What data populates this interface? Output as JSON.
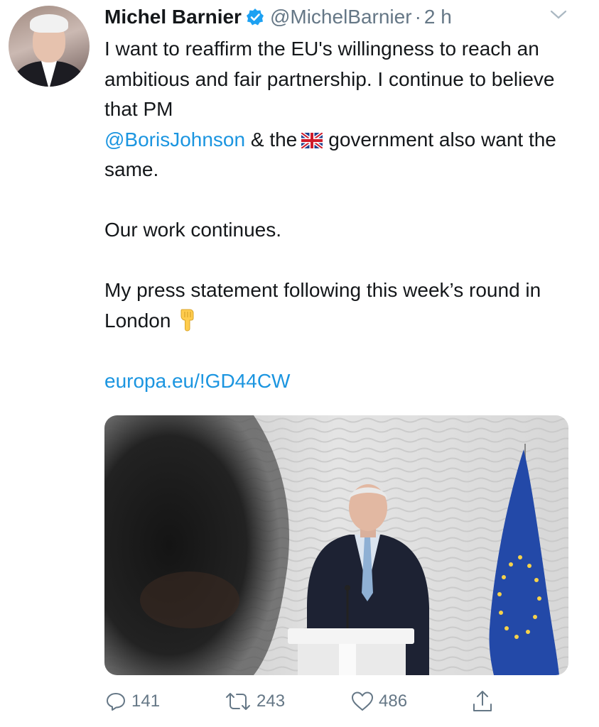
{
  "author": {
    "name": "Michel Barnier",
    "handle": "@MichelBarnier",
    "separator": "·",
    "time": "2 h"
  },
  "tweet": {
    "line1": "I want to reaffirm the EU's willingness to reach an ambitious and fair partnership. I continue to believe that PM",
    "mention": "@BorisJohnson",
    "line2_pre": "& the",
    "line2_post": "government also want the same.",
    "para2": "Our work continues.",
    "para3": "My press statement following this week’s round in London",
    "link": "europa.eu/!GD44CW"
  },
  "actions": {
    "replies": "141",
    "retweets": "243",
    "likes": "486"
  },
  "colors": {
    "link": "#1b95e0",
    "muted": "#657786",
    "text": "#14171a"
  },
  "icons": [
    "verified-badge-icon",
    "chevron-down-icon",
    "uk-flag-icon",
    "pointing-down-emoji",
    "reply-icon",
    "retweet-icon",
    "like-icon",
    "share-icon"
  ]
}
